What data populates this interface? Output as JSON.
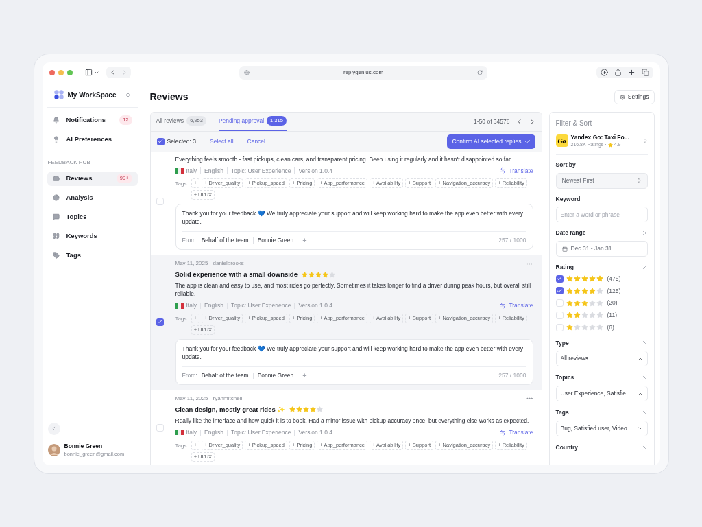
{
  "browser": {
    "url": "replygenius.com"
  },
  "workspace": {
    "name": "My WorkSpace"
  },
  "nav_top": [
    {
      "label": "Notifications",
      "badge": "12",
      "selected": false
    },
    {
      "label": "AI Preferences",
      "selected": false
    }
  ],
  "section_label": "FEEDBACK HUB",
  "nav_hub": [
    {
      "label": "Reviews",
      "badge": "99+",
      "selected": true
    },
    {
      "label": "Analysis",
      "selected": false
    },
    {
      "label": "Topics",
      "selected": false
    },
    {
      "label": "Keywords",
      "selected": false
    },
    {
      "label": "Tags",
      "selected": false
    }
  ],
  "user": {
    "name": "Bonnie Green",
    "email": "bonnie_green@gmail.com"
  },
  "page_title": "Reviews",
  "settings_button": "Settings",
  "tabs": [
    {
      "label": "All reviews",
      "count": "6,953",
      "selected": false
    },
    {
      "label": "Pending approval",
      "count": "1,315",
      "selected": true
    }
  ],
  "pagination": "1-50 of 34578",
  "selection": {
    "checked": true,
    "label": "Selected: 3",
    "select_all": "Select all",
    "cancel": "Cancel",
    "confirm": "Confirm AI selected replies"
  },
  "reviews": [
    {
      "body": "Everything feels smooth - fast pickups, clean cars, and transparent pricing. Been using it regularly and it hasn't disappointed so far.",
      "country": "Italy",
      "language": "English",
      "topic": "Topic: User Experience",
      "version": "Version 1.0.4",
      "translate": "Translate",
      "tags_label": "Tags:",
      "tags": [
        "+",
        "+ Driver_quality",
        "+ Pickup_speed",
        "+ Pricing",
        "+ App_performance",
        "+ Availability",
        "+ Support",
        "+ Navigation_accuracy",
        "+ Reliability",
        "+ UI/UX"
      ],
      "checked": false,
      "reply": {
        "text": "Thank you for your feedback 💙 We truly appreciate your support and will keep working hard to make the app even better with every update.",
        "from_label": "From:",
        "team": "Behalf of the team",
        "author": "Bonnie Green",
        "add": "+",
        "count": "257 / 1000"
      }
    },
    {
      "meta": "May 11, 2025 - danielbrooks",
      "title": "Solid experience with a small downside",
      "stars": 4,
      "body": "The app is clean and easy to use, and most rides go perfectly. Sometimes it takes longer to find a driver during peak hours, but overall still reliable.",
      "country": "Italy",
      "language": "English",
      "topic": "Topic: User Experience",
      "version": "Version 1.0.4",
      "translate": "Translate",
      "tags_label": "Tags:",
      "tags": [
        "+",
        "+ Driver_quality",
        "+ Pickup_speed",
        "+ Pricing",
        "+ App_performance",
        "+ Availability",
        "+ Support",
        "+ Navigation_accuracy",
        "+ Reliability",
        "+ UI/UX"
      ],
      "checked": true,
      "reply": {
        "text": "Thank you for your feedback 💙 We truly appreciate your support and will keep working hard to make the app even better with every update.",
        "from_label": "From:",
        "team": "Behalf of the team",
        "author": "Bonnie Green",
        "add": "+",
        "count": "257 / 1000"
      }
    },
    {
      "meta": "May 11, 2025 - ryanmitchell",
      "title": "Clean design, mostly great rides ✨",
      "stars": 4,
      "body": "Really like the interface and how quick it is to book. Had a minor issue with pickup accuracy once, but everything else works as expected.",
      "country": "Italy",
      "language": "English",
      "topic": "Topic: User Experience",
      "version": "Version 1.0.4",
      "translate": "Translate",
      "tags_label": "Tags:",
      "tags": [
        "+",
        "+ Driver_quality",
        "+ Pickup_speed",
        "+ Pricing",
        "+ App_performance",
        "+ Availability",
        "+ Support",
        "+ Navigation_accuracy",
        "+ Reliability",
        "+ UI/UX"
      ],
      "checked": false
    }
  ],
  "filters": {
    "title": "Filter & Sort",
    "app": {
      "logo_text": "Go",
      "name": "Yandex Go: Taxi Fo...",
      "ratings": "216.8K Ratings ·",
      "score": "4.9"
    },
    "sort": {
      "label": "Sort by",
      "value": "Newest First"
    },
    "keyword": {
      "label": "Keyword",
      "placeholder": "Enter a word or phrase"
    },
    "date": {
      "label": "Date range",
      "value": "Dec 31 - Jan 31"
    },
    "rating": {
      "label": "Rating",
      "options": [
        {
          "stars": 5,
          "count": "(475)",
          "checked": true
        },
        {
          "stars": 4,
          "count": "(125)",
          "checked": true
        },
        {
          "stars": 3,
          "count": "(20)",
          "checked": false
        },
        {
          "stars": 2,
          "count": "(11)",
          "checked": false
        },
        {
          "stars": 1,
          "count": "(6)",
          "checked": false
        }
      ]
    },
    "selects": [
      {
        "label": "Type",
        "value": "All reviews",
        "expanded": true
      },
      {
        "label": "Topics",
        "value": "User Experience, Satisfie...",
        "expanded": true
      },
      {
        "label": "Tags",
        "value": "Bug, Satisfied user, Video...",
        "expanded": false
      }
    ],
    "country": {
      "label": "Country"
    }
  }
}
